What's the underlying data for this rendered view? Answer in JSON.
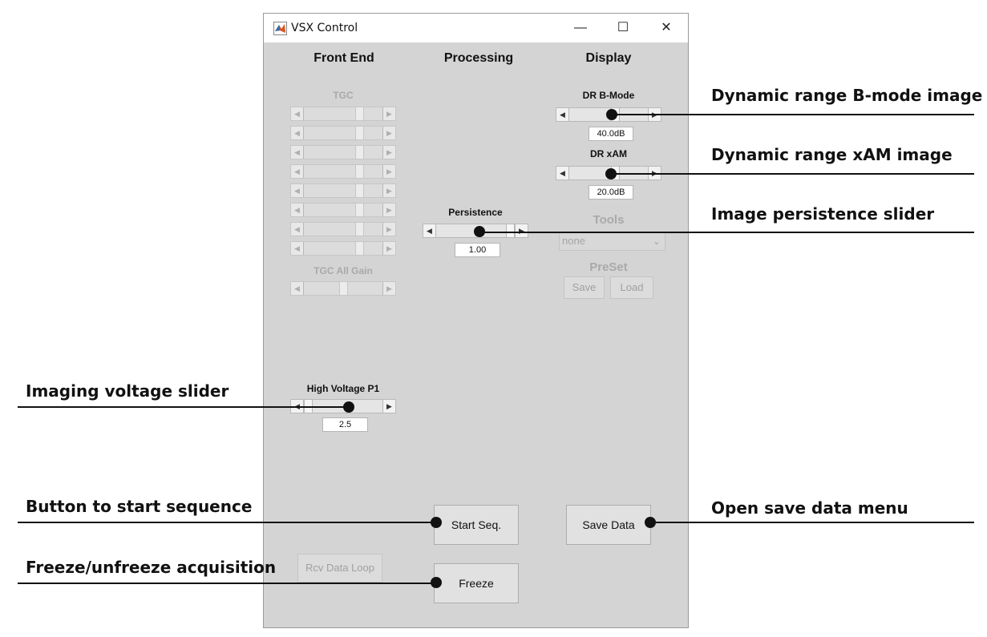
{
  "window": {
    "title": "VSX Control",
    "icon": "matlab-icon",
    "controls": {
      "minimize": "—",
      "maximize": "☐",
      "close": "✕"
    }
  },
  "columns": {
    "front_end": "Front End",
    "processing": "Processing",
    "display": "Display"
  },
  "front_end": {
    "tgc_label": "TGC",
    "tgc_sliders": [
      0.74,
      0.74,
      0.74,
      0.74,
      0.74,
      0.74,
      0.74,
      0.74
    ],
    "tgc_all_gain_label": "TGC All Gain",
    "tgc_all_gain_value": 0.5,
    "high_voltage_label": "High Voltage P1",
    "high_voltage_value": "2.5",
    "high_voltage_level": 0.0,
    "rcv_data_loop": "Rcv Data Loop"
  },
  "processing": {
    "persistence_label": "Persistence",
    "persistence_value": "1.00",
    "persistence_level": 1.0,
    "start_seq": "Start Seq.",
    "freeze": "Freeze"
  },
  "display": {
    "dr_bmode_label": "DR B-Mode",
    "dr_bmode_value": "40.0dB",
    "dr_bmode_level": 0.6,
    "dr_xam_label": "DR xAM",
    "dr_xam_value": "20.0dB",
    "dr_xam_level": 0.6,
    "tools_label": "Tools",
    "tools_selected": "none",
    "preset_label": "PreSet",
    "preset_save": "Save",
    "preset_load": "Load",
    "save_data": "Save Data"
  },
  "annotations": {
    "dr_bmode": "Dynamic range B-mode image",
    "dr_xam": "Dynamic range xAM image",
    "persistence": "Image persistence slider",
    "voltage": "Imaging voltage slider",
    "start_seq": "Button to start sequence",
    "save_data": "Open save data menu",
    "freeze": "Freeze/unfreeze acquisition"
  }
}
